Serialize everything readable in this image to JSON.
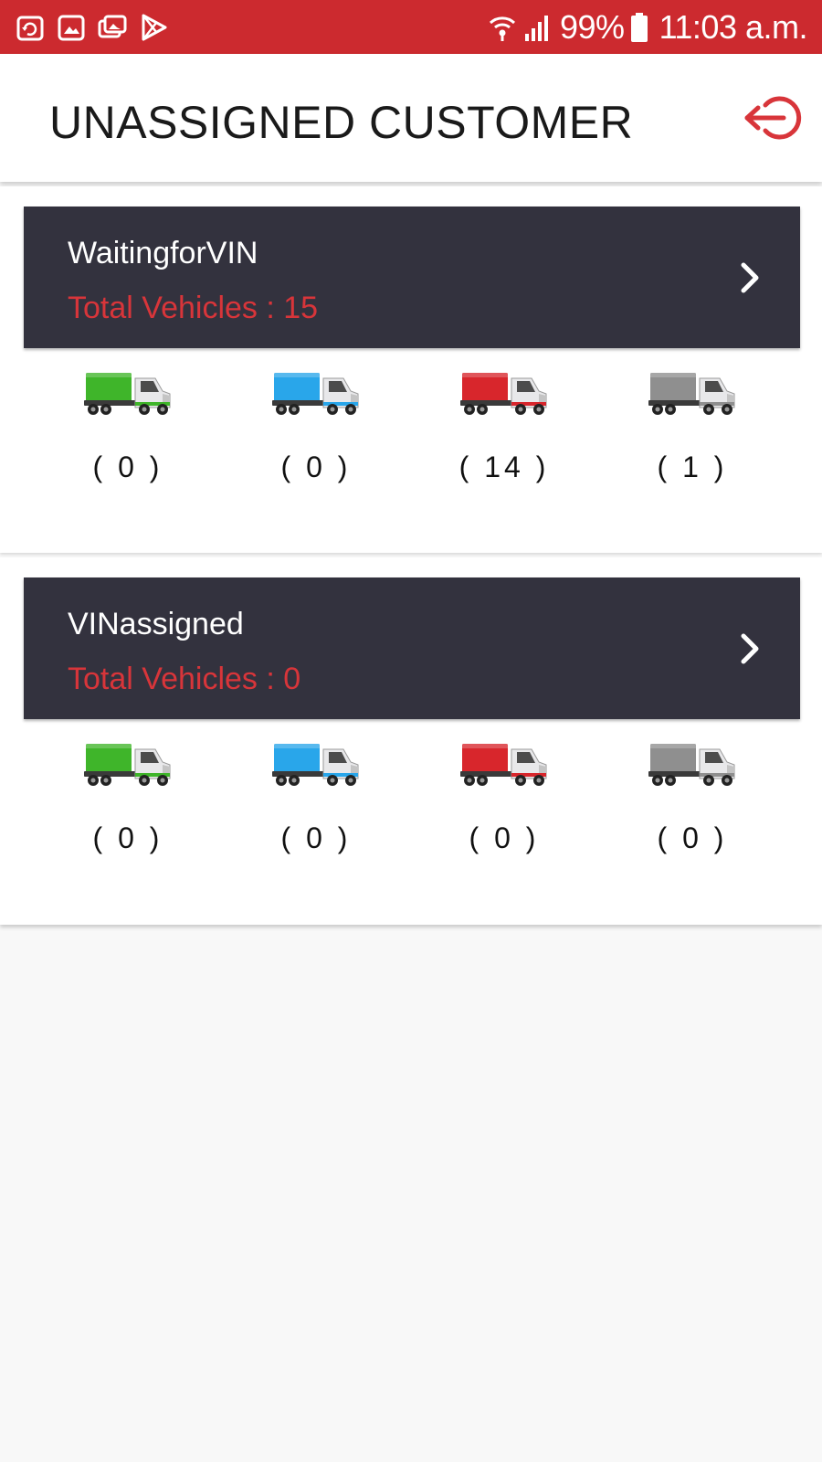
{
  "status_bar": {
    "battery_text": "99%",
    "clock_text": "11:03 a.m.",
    "icons_left": [
      "sync-icon",
      "image-icon",
      "photos-icon",
      "play-store-icon"
    ],
    "icons_right": [
      "wifi-icon",
      "signal-icon",
      "battery-icon"
    ]
  },
  "header": {
    "title": "UNASSIGNED CUSTOMER",
    "logout_icon": "logout-icon"
  },
  "colors": {
    "status_bar": "#cc2a2f",
    "accent_red": "#d8353a",
    "card_dark": "#33323e",
    "truck_green": "#3fb52a",
    "truck_blue": "#29a6ea",
    "truck_red": "#d8262c",
    "truck_gray": "#8f8f8f"
  },
  "groups": [
    {
      "name": "WaitingforVIN",
      "total_text": "Total Vehicles : 15",
      "counts": [
        {
          "color": "green",
          "value": 0,
          "label": "( 0 )"
        },
        {
          "color": "blue",
          "value": 0,
          "label": "( 0 )"
        },
        {
          "color": "red",
          "value": 14,
          "label": "( 14 )"
        },
        {
          "color": "gray",
          "value": 1,
          "label": "( 1 )"
        }
      ]
    },
    {
      "name": "VINassigned",
      "total_text": "Total Vehicles : 0",
      "counts": [
        {
          "color": "green",
          "value": 0,
          "label": "( 0 )"
        },
        {
          "color": "blue",
          "value": 0,
          "label": "( 0 )"
        },
        {
          "color": "red",
          "value": 0,
          "label": "( 0 )"
        },
        {
          "color": "gray",
          "value": 0,
          "label": "( 0 )"
        }
      ]
    }
  ]
}
